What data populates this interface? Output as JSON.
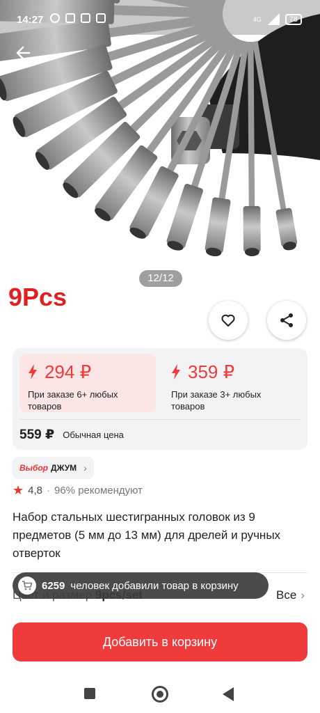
{
  "status_bar": {
    "time": "14:27",
    "network": "4G",
    "battery": "78"
  },
  "gallery": {
    "promo_text": "9Pcs",
    "counter": "12/12"
  },
  "prices": {
    "tiers": [
      {
        "price": "294 ₽",
        "condition": "При заказе 6+ любых товаров"
      },
      {
        "price": "359 ₽",
        "condition": "При заказе 3+ любых товаров"
      }
    ],
    "regular_price": "559 ₽",
    "regular_label": "Обычная цена"
  },
  "brand": {
    "prefix": "Выбор",
    "name": "ДЖУМ"
  },
  "rating": {
    "score": "4,8",
    "recommend": "96% рекомендуют"
  },
  "product_title": "Набор стальных шестигранных головок из 9 предметов (5 мм до 13 мм) для дрелей и ручных отверток",
  "variant": {
    "label": "Цвет и размер",
    "value": "9pcs/set",
    "all": "Все"
  },
  "toast": {
    "count": "6259",
    "text": "человек добавили товар в корзину"
  },
  "add_to_cart": "Добавить в корзину",
  "colors": {
    "accent": "#ef3b3b",
    "tier_bg": "#fbe5e5",
    "card_bg": "#f3f3f5"
  }
}
